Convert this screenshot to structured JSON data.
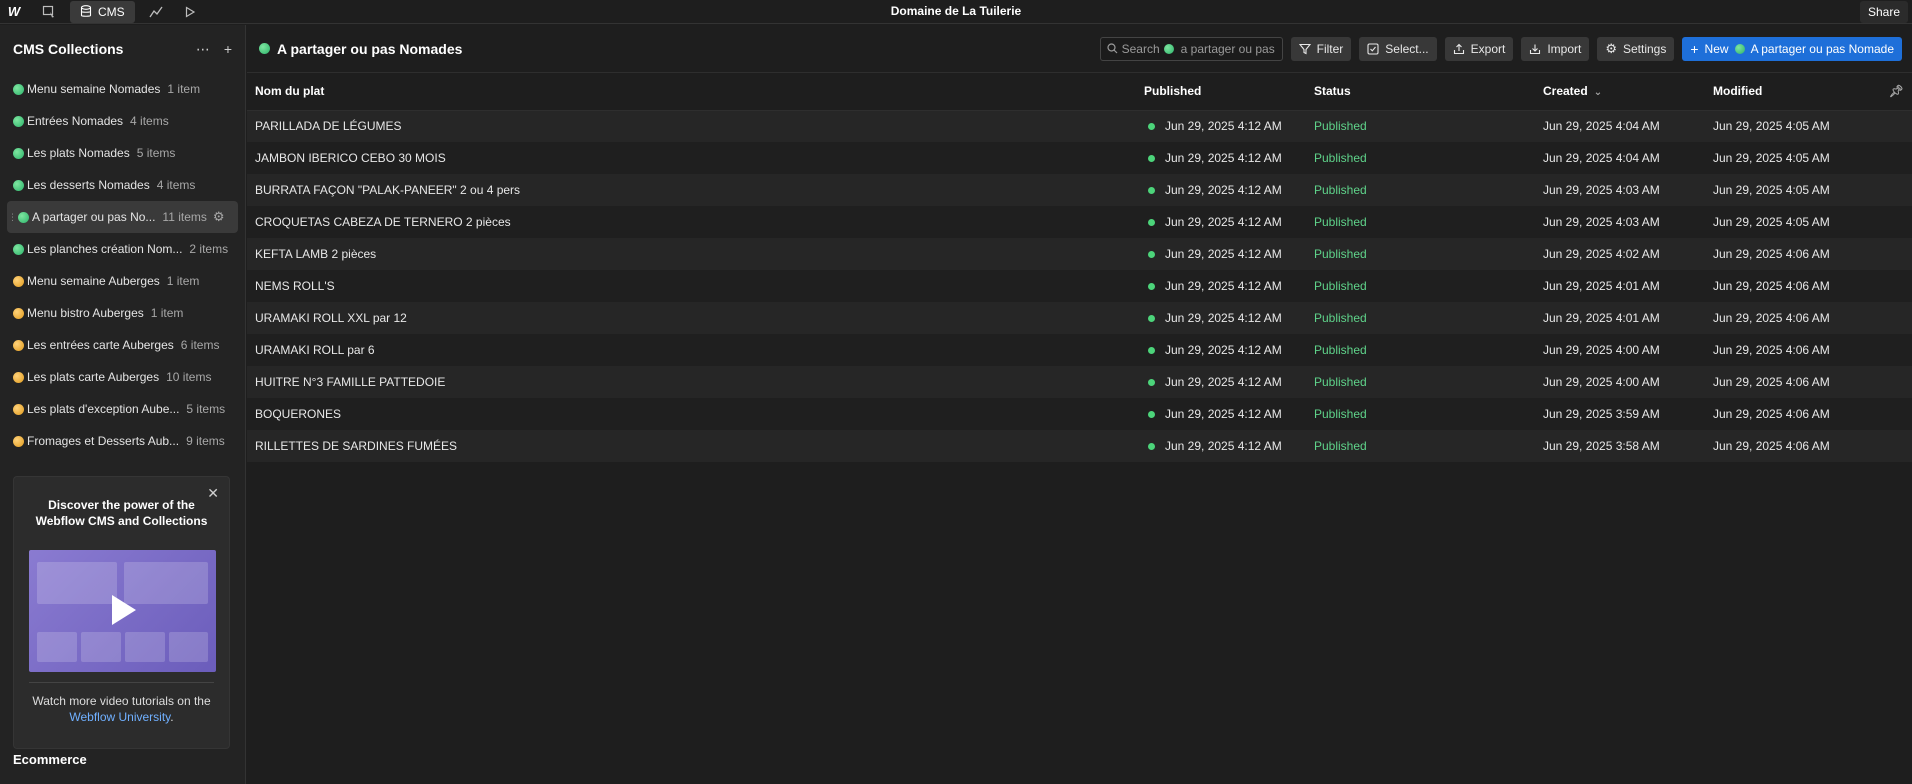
{
  "topbar": {
    "logo": "W",
    "cms_label": "CMS",
    "site_title": "Domaine de La Tuilerie",
    "share_label": "Share"
  },
  "sidebar": {
    "title": "CMS Collections",
    "items": [
      {
        "name": "Menu semaine Nomades",
        "count": "1 item",
        "color": "green"
      },
      {
        "name": "Entrées Nomades",
        "count": "4 items",
        "color": "green"
      },
      {
        "name": "Les plats Nomades",
        "count": "5 items",
        "color": "green"
      },
      {
        "name": "Les desserts Nomades",
        "count": "4 items",
        "color": "green"
      },
      {
        "name": "A partager ou pas No...",
        "count": "11 items",
        "color": "green",
        "active": true
      },
      {
        "name": "Les planches création Nom...",
        "count": "2 items",
        "color": "green"
      },
      {
        "name": "Menu semaine Auberges",
        "count": "1 item",
        "color": "orange"
      },
      {
        "name": "Menu bistro Auberges",
        "count": "1 item",
        "color": "orange"
      },
      {
        "name": "Les entrées carte Auberges",
        "count": "6 items",
        "color": "orange"
      },
      {
        "name": "Les plats carte Auberges",
        "count": "10 items",
        "color": "orange"
      },
      {
        "name": "Les plats d'exception Aube...",
        "count": "5 items",
        "color": "orange"
      },
      {
        "name": "Fromages et Desserts Aub...",
        "count": "9 items",
        "color": "orange"
      }
    ],
    "promo": {
      "title": "Discover the power of the Webflow CMS and Collections",
      "text": "Watch more video tutorials on the",
      "link": "Webflow University",
      "end": "."
    },
    "ecommerce_label": "Ecommerce"
  },
  "main": {
    "collection_title": "A partager ou pas Nomades",
    "search_placeholder": "Search",
    "search_scope": "a partager ou pas",
    "filter_label": "Filter",
    "select_label": "Select...",
    "export_label": "Export",
    "import_label": "Import",
    "settings_label": "Settings",
    "new_label": "New",
    "new_target": "A partager ou pas Nomade",
    "columns": [
      "Nom du plat",
      "Published",
      "Status",
      "Created",
      "Modified"
    ],
    "rows": [
      {
        "name": "PARILLADA DE LÉGUMES",
        "published": "Jun 29, 2025 4:12 AM",
        "status": "Published",
        "created": "Jun 29, 2025 4:04 AM",
        "modified": "Jun 29, 2025 4:05 AM"
      },
      {
        "name": "JAMBON IBERICO CEBO 30 MOIS",
        "published": "Jun 29, 2025 4:12 AM",
        "status": "Published",
        "created": "Jun 29, 2025 4:04 AM",
        "modified": "Jun 29, 2025 4:05 AM"
      },
      {
        "name": "BURRATA FAÇON \"PALAK-PANEER\" 2 ou 4 pers",
        "published": "Jun 29, 2025 4:12 AM",
        "status": "Published",
        "created": "Jun 29, 2025 4:03 AM",
        "modified": "Jun 29, 2025 4:05 AM"
      },
      {
        "name": "CROQUETAS CABEZA DE TERNERO 2 pièces",
        "published": "Jun 29, 2025 4:12 AM",
        "status": "Published",
        "created": "Jun 29, 2025 4:03 AM",
        "modified": "Jun 29, 2025 4:05 AM"
      },
      {
        "name": "KEFTA LAMB 2 pièces",
        "published": "Jun 29, 2025 4:12 AM",
        "status": "Published",
        "created": "Jun 29, 2025 4:02 AM",
        "modified": "Jun 29, 2025 4:06 AM"
      },
      {
        "name": "NEMS ROLL'S",
        "published": "Jun 29, 2025 4:12 AM",
        "status": "Published",
        "created": "Jun 29, 2025 4:01 AM",
        "modified": "Jun 29, 2025 4:06 AM"
      },
      {
        "name": "URAMAKI ROLL XXL par 12",
        "published": "Jun 29, 2025 4:12 AM",
        "status": "Published",
        "created": "Jun 29, 2025 4:01 AM",
        "modified": "Jun 29, 2025 4:06 AM"
      },
      {
        "name": "URAMAKI ROLL par 6",
        "published": "Jun 29, 2025 4:12 AM",
        "status": "Published",
        "created": "Jun 29, 2025 4:00 AM",
        "modified": "Jun 29, 2025 4:06 AM"
      },
      {
        "name": "HUITRE N°3 FAMILLE PATTEDOIE",
        "published": "Jun 29, 2025 4:12 AM",
        "status": "Published",
        "created": "Jun 29, 2025 4:00 AM",
        "modified": "Jun 29, 2025 4:06 AM"
      },
      {
        "name": "BOQUERONES",
        "published": "Jun 29, 2025 4:12 AM",
        "status": "Published",
        "created": "Jun 29, 2025 3:59 AM",
        "modified": "Jun 29, 2025 4:06 AM"
      },
      {
        "name": "RILLETTES DE SARDINES FUMÉES",
        "published": "Jun 29, 2025 4:12 AM",
        "status": "Published",
        "created": "Jun 29, 2025 3:58 AM",
        "modified": "Jun 29, 2025 4:06 AM"
      }
    ]
  },
  "colors": {
    "accent": "#1e6fd9",
    "published_green": "#5fd38a",
    "nomades_dot": "#2bb36a",
    "auberges_dot": "#e09a1c",
    "link": "#70b0ff"
  }
}
